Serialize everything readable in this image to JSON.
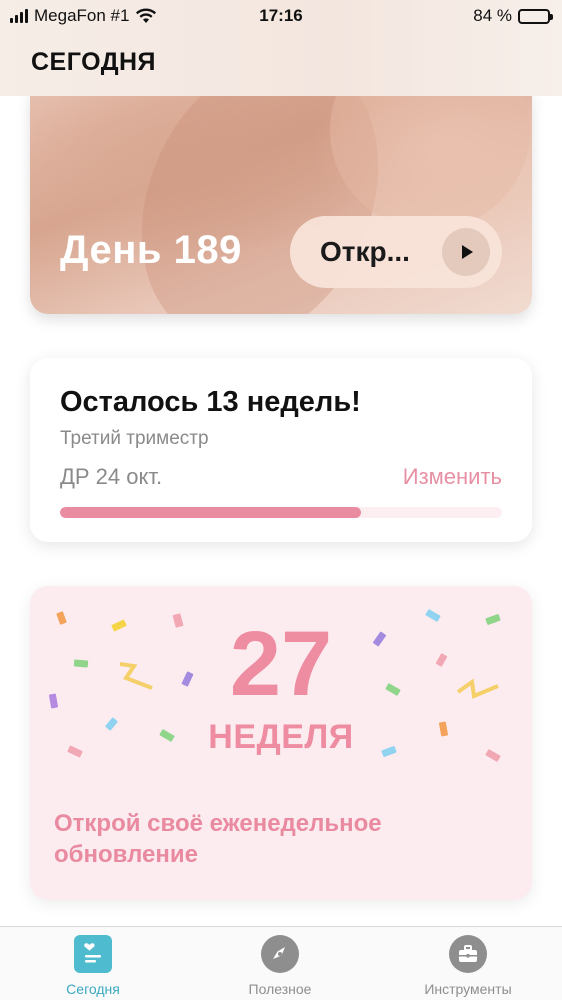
{
  "status_bar": {
    "carrier": "MegaFon #1",
    "time": "17:16",
    "battery_text": "84 %",
    "battery_level": 0.84
  },
  "header": {
    "title": "СЕГОДНЯ"
  },
  "hero": {
    "day_label": "День 189",
    "open_button_label": "Откр...",
    "play_icon": "play-icon"
  },
  "weeks_card": {
    "title": "Осталось 13 недель!",
    "subtitle": "Третий триместр",
    "due_date": "ДР 24 окт.",
    "change_label": "Изменить",
    "progress": 0.68,
    "accent_color": "#ea8ca1"
  },
  "week_card": {
    "number": "27",
    "word": "НЕДЕЛЯ",
    "cta": "Открой своё еженедельное обновление"
  },
  "tabbar": {
    "items": [
      {
        "label": "Сегодня",
        "icon": "calendar-heart-icon",
        "active": true
      },
      {
        "label": "Полезное",
        "icon": "compass-icon",
        "active": false
      },
      {
        "label": "Инструменты",
        "icon": "toolbox-icon",
        "active": false
      }
    ],
    "active_color": "#3aa9c1",
    "inactive_color": "#8e8e8e"
  }
}
